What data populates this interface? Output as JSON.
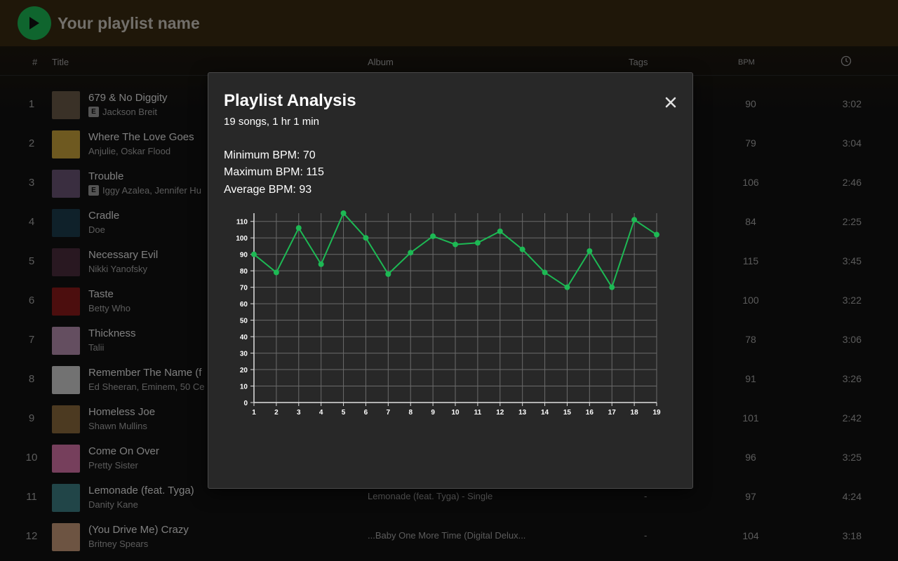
{
  "header": {
    "playlist_name": "Your playlist name"
  },
  "columns": {
    "num": "#",
    "title": "Title",
    "album": "Album",
    "tags": "Tags",
    "bpm": "BPM"
  },
  "tracks": [
    {
      "num": "1",
      "title": "679 & No Diggity",
      "artist": "Jackson Breit",
      "explicit": true,
      "album": "",
      "tags": "",
      "bpm": "90",
      "duration": "3:02",
      "art_color": "#6b5a48"
    },
    {
      "num": "2",
      "title": "Where The Love Goes",
      "artist": "Anjulie, Oskar Flood",
      "explicit": false,
      "album": "",
      "tags": "",
      "bpm": "79",
      "duration": "3:04",
      "art_color": "#c9a23b"
    },
    {
      "num": "3",
      "title": "Trouble",
      "artist": "Iggy Azalea, Jennifer Hu",
      "explicit": true,
      "album": "",
      "tags": "",
      "bpm": "106",
      "duration": "2:46",
      "art_color": "#6a5475"
    },
    {
      "num": "4",
      "title": "Cradle",
      "artist": "Doe",
      "explicit": false,
      "album": "",
      "tags": "",
      "bpm": "84",
      "duration": "2:25",
      "art_color": "#1d3c4e"
    },
    {
      "num": "5",
      "title": "Necessary Evil",
      "artist": "Nikki Yanofsky",
      "explicit": false,
      "album": "",
      "tags": "",
      "bpm": "115",
      "duration": "3:45",
      "art_color": "#4b2c3c"
    },
    {
      "num": "6",
      "title": "Taste",
      "artist": "Betty Who",
      "explicit": false,
      "album": "",
      "tags": "",
      "bpm": "100",
      "duration": "3:22",
      "art_color": "#8b1b1b"
    },
    {
      "num": "7",
      "title": "Thickness",
      "artist": "Talii",
      "explicit": false,
      "album": "",
      "tags": "",
      "bpm": "78",
      "duration": "3:06",
      "art_color": "#b78fb0"
    },
    {
      "num": "8",
      "title": "Remember The Name (f",
      "artist": "Ed Sheeran, Eminem, 50 Ce",
      "explicit": false,
      "album": "",
      "tags": "",
      "bpm": "91",
      "duration": "3:26",
      "art_color": "#d0d0d0"
    },
    {
      "num": "9",
      "title": "Homeless Joe",
      "artist": "Shawn Mullins",
      "explicit": false,
      "album": "",
      "tags": "",
      "bpm": "101",
      "duration": "2:42",
      "art_color": "#8a6a3c"
    },
    {
      "num": "10",
      "title": "Come On Over",
      "artist": "Pretty Sister",
      "explicit": false,
      "album": "",
      "tags": "",
      "bpm": "96",
      "duration": "3:25",
      "art_color": "#d873a8"
    },
    {
      "num": "11",
      "title": "Lemonade (feat. Tyga)",
      "artist": "Danity Kane",
      "explicit": false,
      "album": "Lemonade (feat. Tyga) - Single",
      "tags": "-",
      "bpm": "97",
      "duration": "4:24",
      "art_color": "#3d7f84"
    },
    {
      "num": "12",
      "title": "(You Drive Me) Crazy",
      "artist": "Britney Spears",
      "explicit": false,
      "album": "...Baby One More Time (Digital Delux...",
      "tags": "-",
      "bpm": "104",
      "duration": "3:18",
      "art_color": "#c79a78"
    }
  ],
  "modal": {
    "title": "Playlist Analysis",
    "subtitle": "19 songs, 1 hr 1 min",
    "min_bpm": "Minimum BPM: 70",
    "max_bpm": "Maximum BPM: 115",
    "avg_bpm": "Average BPM: 93",
    "close_glyph": "✕"
  },
  "colors": {
    "accent": "#1db954",
    "header_bg": "#3a2a11",
    "modal_bg": "#282828"
  },
  "chart_data": {
    "type": "line",
    "x": [
      1,
      2,
      3,
      4,
      5,
      6,
      7,
      8,
      9,
      10,
      11,
      12,
      13,
      14,
      15,
      16,
      17,
      18,
      19
    ],
    "series": [
      {
        "values": [
          90,
          79,
          106,
          84,
          115,
          100,
          78,
          91,
          101,
          96,
          97,
          104,
          93,
          79,
          70,
          92,
          70,
          111,
          102
        ]
      }
    ],
    "y_ticks": [
      0,
      10,
      20,
      30,
      40,
      50,
      60,
      70,
      80,
      90,
      100,
      110
    ],
    "ylim": [
      0,
      115
    ],
    "xlim": [
      1,
      19
    ],
    "grid": true,
    "line_color": "#1db954"
  }
}
